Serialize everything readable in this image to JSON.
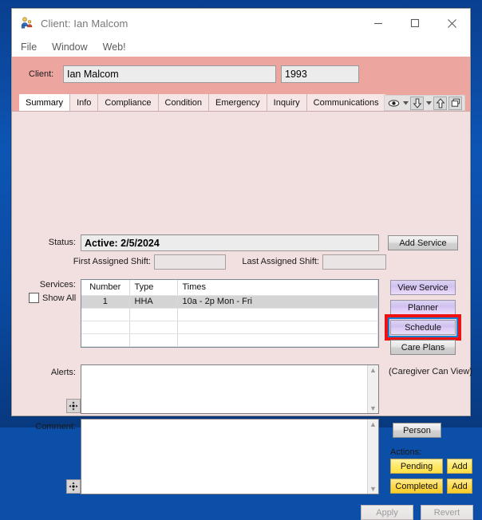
{
  "window": {
    "title": "Client: Ian Malcom",
    "app_icon": "people-icon",
    "minimize_label": "Minimize",
    "maximize_label": "Maximize",
    "close_label": "Close"
  },
  "menubar": {
    "items": [
      "File",
      "Window",
      "Web!"
    ]
  },
  "header": {
    "client_label": "Client:",
    "client_name": "Ian Malcom",
    "client_name_placeholder": "",
    "client_id": "1993",
    "client_id_placeholder": ""
  },
  "tabs": [
    {
      "label": "Summary",
      "selected": true
    },
    {
      "label": "Info",
      "selected": false
    },
    {
      "label": "Compliance",
      "selected": false
    },
    {
      "label": "Condition",
      "selected": false
    },
    {
      "label": "Emergency",
      "selected": false
    },
    {
      "label": "Inquiry",
      "selected": false
    },
    {
      "label": "Communications",
      "selected": false
    }
  ],
  "tab_tools": [
    {
      "name": "eye-icon",
      "caret": true
    },
    {
      "name": "arrow-down-icon",
      "caret": true
    },
    {
      "name": "arrow-up-icon",
      "caret": false
    },
    {
      "name": "restore-window-icon",
      "caret": false
    }
  ],
  "summary": {
    "status_label": "Status:",
    "status_value": "Active: 2/5/2024",
    "first_shift_label": "First Assigned Shift:",
    "first_shift_value": "",
    "last_shift_label": "Last Assigned Shift:",
    "last_shift_value": "",
    "services_label": "Services:",
    "show_all_label": "Show All",
    "show_all_checked": false,
    "alerts_label": "Alerts:",
    "alerts_value": "",
    "comment_label": "Comment:",
    "comment_value": "",
    "caregiver_note": "(Caregiver Can View)",
    "actions_label": "Actions:"
  },
  "services_table": {
    "columns": [
      "Number",
      "Type",
      "Times"
    ],
    "rows": [
      {
        "number": "1",
        "type": "HHA",
        "times": "10a - 2p Mon - Fri",
        "selected": true
      },
      {
        "number": "",
        "type": "",
        "times": "",
        "selected": false
      },
      {
        "number": "",
        "type": "",
        "times": "",
        "selected": false
      },
      {
        "number": "",
        "type": "",
        "times": "",
        "selected": false
      },
      {
        "number": "",
        "type": "",
        "times": "",
        "selected": false
      }
    ]
  },
  "buttons": {
    "add_service": "Add Service",
    "view_service": "View Service",
    "planner": "Planner",
    "schedule": "Schedule",
    "care_plans": "Care Plans",
    "person": "Person",
    "pending": "Pending",
    "add_pending": "Add",
    "completed": "Completed",
    "add_completed": "Add",
    "apply": "Apply",
    "revert": "Revert"
  },
  "state": {
    "focused_button": "Schedule",
    "apply_enabled": false,
    "revert_enabled": false
  },
  "colors": {
    "desktop": "#0d55b4",
    "header_pink": "#eda5a0",
    "body_pink": "#f2dfdf",
    "highlight_red": "#ee1111",
    "focus_blue": "#1a7fd4",
    "lavender_button": "#cfc0ef",
    "yellow_button": "#ffe866",
    "selected_row": "#d4d4d4"
  }
}
